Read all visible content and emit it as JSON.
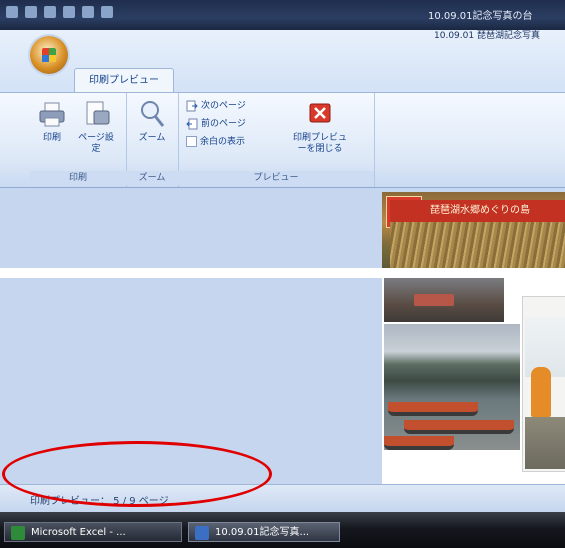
{
  "window": {
    "title_right": "10.09.01記念写真の台",
    "doc_title": "10.09.01 琵琶湖記念写真"
  },
  "ribbon": {
    "tab_label": "印刷プレビュー",
    "groups": [
      {
        "label": "印刷"
      },
      {
        "label": "ズーム"
      },
      {
        "label": "プレビュー"
      }
    ],
    "print_label": "印刷",
    "page_setup_label": "ページ設定",
    "zoom_label": "ズーム",
    "next_page_label": "次のページ",
    "prev_page_label": "前のページ",
    "show_margins_label": "余白の表示",
    "close_preview_label": "印刷プレビューを閉じる"
  },
  "preview": {
    "banner_text": "琵琶湖水郷めぐりの島"
  },
  "statusbar": {
    "text": "印刷プレビュー： 5 / 9 ページ"
  },
  "taskbar": {
    "items": [
      {
        "label": "Microsoft Excel - ..."
      },
      {
        "label": "10.09.01記念写真..."
      }
    ]
  },
  "colors": {
    "annotation": "#e00000",
    "ribbon_text": "#15428b"
  }
}
